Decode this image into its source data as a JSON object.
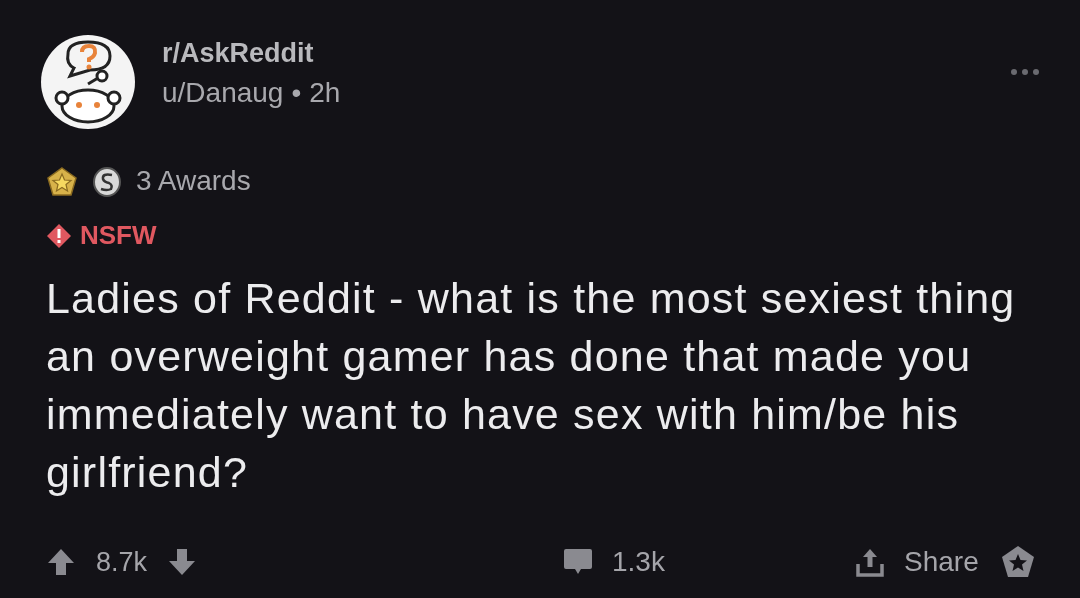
{
  "post": {
    "subreddit": "r/AskReddit",
    "author": "u/Danaug",
    "separator": "•",
    "age": "2h",
    "awards": "3 Awards",
    "nsfw": "NSFW",
    "title": "Ladies of Reddit - what is the most sexiest thing an overweight gamer has done that made you immediately want to have sex with him/be his girlfriend?"
  },
  "actions": {
    "upvotes": "8.7k",
    "comments": "1.3k",
    "share": "Share"
  }
}
